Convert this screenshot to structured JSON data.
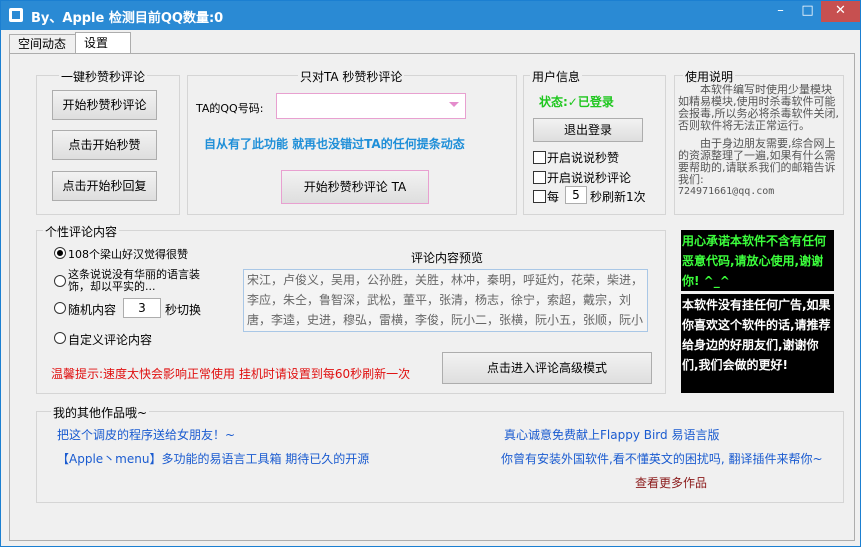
{
  "window": {
    "title": "By、Apple 检测目前QQ数量:0",
    "min": "–",
    "max": "□",
    "close": "✕"
  },
  "tabs": [
    "空间动态",
    "设置"
  ],
  "one_click": {
    "title": "一键秒赞秒评论",
    "buttons": [
      "开始秒赞秒评论",
      "点击开始秒赞",
      "点击开始秒回复"
    ]
  },
  "target": {
    "title": "只对TA  秒赞秒评论",
    "qq_label": "TA的QQ号码:",
    "qq_value": "",
    "hint": "自从有了此功能 就再也没错过TA的任何提条动态",
    "start_button": "开始秒赞秒评论 TA"
  },
  "user": {
    "title": "用户信息",
    "status": "状态:✓已登录",
    "logout_button": "退出登录",
    "chk_like": "开启说说秒赞",
    "chk_comment": "开启说说秒评论",
    "every": "每",
    "seconds": "5",
    "refresh": "秒刷新1次"
  },
  "instructions": {
    "title": "使用说明",
    "para1": "本软件编写时使用少量模块如精易模块,使用时杀毒软件可能会报毒,所以务必将杀毒软件关闭,否则软件将无法正常运行。",
    "para2": "由于身边朋友需要,综合网上的资源整理了一遍,如果有什么需要帮助的,请联系我们的邮箱告诉我们:",
    "email": "724971661@qq.com",
    "banner1": "用心承诺本软件不含有任何恶意代码,请放心使用,谢谢你! ^_^",
    "banner2": "本软件没有挂任何广告,如果你喜欢这个软件的话,请推荐给身边的好朋友们,谢谢你们,我们会做的更好!"
  },
  "comment": {
    "title": "个性评论内容",
    "opt1": "108个梁山好汉觉得很赞",
    "opt2": "这条说说没有华丽的语言装饰，却以平实的...",
    "opt3": "随机内容",
    "opt3_seconds": "3",
    "opt3_suffix": "秒切换",
    "opt4": "自定义评论内容",
    "preview_title": "评论内容预览",
    "preview_text": "宋江，卢俊义，吴用，公孙胜，关胜，林冲，秦明，呼延灼，花荣，柴进，李应，朱仝，鲁智深，武松，董平，张清，杨志，徐宁，索超，戴宗，刘唐，李逵，史进，穆弘，雷横，李俊，阮小二，张横，阮小五，张顺，阮小七",
    "tip": "温馨提示:速度太快会影响正常使用  挂机时请设置到每60秒刷新一次",
    "advanced_button": "点击进入评论高级模式"
  },
  "works": {
    "title": "我的其他作品哦~",
    "link1": "把这个调皮的程序送给女朋友！~",
    "link2": "【Apple丶menu】多功能的易语言工具箱 期待已久的开源",
    "link3": "真心诚意免费献上Flappy Bird 易语言版",
    "link4": "你曾有安装外国软件,看不懂英文的困扰吗, 翻译插件来帮你~",
    "more": "查看更多作品"
  },
  "colors": {
    "titlebar": "#2a8ad4",
    "link": "#1a5bd0",
    "status_green": "#1ec71e",
    "banner_green": "#3cff3c",
    "alert_red": "#e01010"
  }
}
